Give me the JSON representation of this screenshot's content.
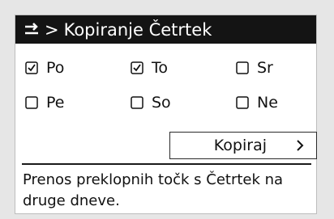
{
  "header": {
    "icon": "copy-arrow-icon",
    "separator": ">",
    "title": "Kopiranje Četrtek"
  },
  "days": [
    {
      "label": "Po",
      "checked": true
    },
    {
      "label": "To",
      "checked": true
    },
    {
      "label": "Sr",
      "checked": false
    },
    {
      "label": "Pe",
      "checked": false
    },
    {
      "label": "So",
      "checked": false
    },
    {
      "label": "Ne",
      "checked": false
    }
  ],
  "button": {
    "label": "Kopiraj",
    "icon": "chevron-right-icon"
  },
  "description": "Prenos preklopnih točk s Četrtek na druge dneve.",
  "colors": {
    "titlebar_bg": "#141414",
    "titlebar_text": "#ffffff",
    "panel_bg": "#ffffff",
    "frame_bg": "#e6e6e6",
    "text": "#111111"
  }
}
